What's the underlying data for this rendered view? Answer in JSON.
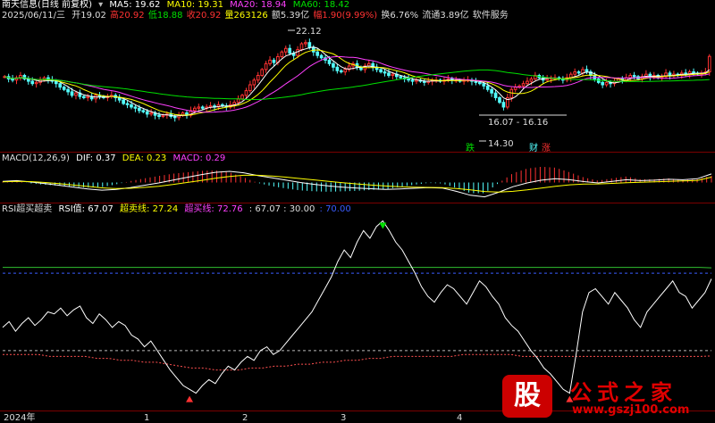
{
  "header": {
    "stock_title": "南天信息(日线 前复权)",
    "ma5": "MA5: 19.62",
    "ma10": "MA10: 19.31",
    "ma20": "MA20: 18.94",
    "ma60": "MA60: 18.42",
    "date": "2025/06/11/三",
    "open": "开19.02",
    "high": "高20.92",
    "low": "低18.88",
    "close": "收20.92",
    "volume": "量263126",
    "amount": "额5.39亿",
    "change": "幅1.90(9.99%)",
    "turnover": "换6.76%",
    "float_cap": "流通3.89亿",
    "industry": "软件服务"
  },
  "macd": {
    "title": "MACD(12,26,9)",
    "dif": "DIF: 0.37",
    "dea": "DEA: 0.23",
    "macd": "MACD: 0.29"
  },
  "rsi": {
    "title": "RSI超买超卖",
    "rsi_value": "RSI值: 67.07",
    "oversold": "超卖线: 27.24",
    "overbought": "超买线: 72.76",
    "levels": ": 67.07 : 30.00",
    "level_blue": ": 70.00"
  },
  "annotations": {
    "high_label": "22.12",
    "low_label": "14.30",
    "range_label": "16.07 - 16.16",
    "tag_die": "跌",
    "tag_cai": "财",
    "tag_zhang": "涨"
  },
  "x_axis": {
    "year": "2024年",
    "months": [
      "1",
      "2",
      "3",
      "4"
    ]
  },
  "watermark": {
    "logo": "股",
    "name": "公式之家",
    "url": "www.gszj100.com"
  },
  "colors": {
    "up": "#ff3232",
    "down": "#54ffff",
    "ma5": "#ffffff",
    "ma10": "#ffff00",
    "ma20": "#ff40ff",
    "ma60": "#00e000",
    "rsi": "#ffffff",
    "oversold": "#ff5050",
    "overbought": "#30c030",
    "level70": "#3a5cff",
    "level30": "#bbbbbb"
  },
  "chart_data": [
    {
      "type": "candlestick",
      "title": "南天信息(日线 前复权)",
      "ylim": [
        13.4,
        23.6
      ],
      "series_names": [
        "MA5",
        "MA10",
        "MA20",
        "MA60"
      ],
      "close": [
        19.2,
        19.0,
        18.9,
        19.1,
        19.3,
        19.0,
        18.8,
        18.6,
        18.7,
        18.9,
        19.1,
        18.9,
        18.8,
        18.6,
        18.3,
        18.1,
        17.9,
        17.6,
        17.8,
        17.5,
        17.4,
        17.5,
        17.3,
        17.6,
        17.5,
        17.4,
        17.5,
        17.6,
        17.4,
        17.2,
        16.9,
        16.8,
        16.6,
        16.5,
        16.3,
        16.2,
        16.0,
        16.1,
        15.9,
        15.8,
        15.9,
        16.0,
        15.8,
        15.7,
        15.9,
        16.1,
        15.9,
        16.3,
        16.5,
        16.6,
        16.5,
        16.6,
        16.7,
        16.6,
        16.8,
        16.7,
        16.6,
        16.8,
        17.0,
        17.3,
        17.6,
        18.0,
        18.5,
        18.9,
        19.3,
        19.8,
        20.3,
        20.6,
        20.4,
        20.9,
        21.3,
        21.6,
        21.2,
        21.0,
        21.5,
        22.0,
        22.1,
        21.7,
        21.3,
        21.0,
        20.8,
        20.6,
        20.3,
        20.0,
        19.7,
        19.6,
        19.8,
        20.1,
        20.3,
        20.0,
        19.8,
        20.1,
        20.3,
        20.0,
        19.8,
        19.6,
        19.5,
        19.3,
        19.4,
        19.2,
        19.1,
        19.0,
        18.9,
        18.8,
        18.9,
        18.8,
        18.7,
        18.8,
        18.9,
        18.9,
        18.8,
        18.9,
        19.0,
        18.9,
        18.9,
        18.8,
        18.9,
        18.9,
        18.8,
        18.7,
        18.6,
        18.4,
        18.1,
        17.8,
        17.4,
        17.0,
        16.6,
        17.4,
        18.1,
        18.3,
        18.4,
        18.6,
        18.8,
        19.0,
        19.3,
        19.1,
        18.9,
        19.0,
        19.1,
        19.1,
        19.0,
        18.9,
        19.1,
        19.4,
        19.6,
        19.5,
        19.8,
        19.6,
        19.3,
        19.0,
        18.7,
        18.5,
        18.7,
        18.6,
        18.8,
        19.0,
        18.9,
        19.1,
        19.3,
        19.2,
        19.0,
        19.2,
        19.4,
        19.2,
        19.3,
        19.1,
        19.2,
        19.5,
        19.3,
        19.4,
        19.3,
        19.5,
        19.4,
        19.6,
        19.5,
        19.4,
        19.5,
        19.6,
        20.92
      ]
    },
    {
      "type": "line",
      "title": "MACD(12,26,9)",
      "series": [
        {
          "name": "DIF",
          "values": [
            0.05,
            0.08,
            0.02,
            -0.05,
            -0.12,
            -0.2,
            -0.28,
            -0.33,
            -0.3,
            -0.22,
            -0.12,
            -0.02,
            0.1,
            0.22,
            0.34,
            0.44,
            0.48,
            0.42,
            0.3,
            0.2,
            0.1,
            0.0,
            -0.08,
            -0.15,
            -0.2,
            -0.24,
            -0.27,
            -0.3,
            -0.28,
            -0.25,
            -0.22,
            -0.24,
            -0.38,
            -0.55,
            -0.62,
            -0.42,
            -0.18,
            -0.02,
            0.1,
            0.16,
            0.12,
            0.04,
            -0.02,
            0.05,
            0.12,
            0.08,
            0.1,
            0.14,
            0.12,
            0.16,
            0.37
          ]
        },
        {
          "name": "DEA",
          "values": [
            0.03,
            0.05,
            0.04,
            0.0,
            -0.05,
            -0.11,
            -0.17,
            -0.23,
            -0.26,
            -0.25,
            -0.21,
            -0.16,
            -0.09,
            0.0,
            0.09,
            0.18,
            0.26,
            0.31,
            0.31,
            0.28,
            0.23,
            0.17,
            0.11,
            0.05,
            -0.01,
            -0.06,
            -0.11,
            -0.15,
            -0.18,
            -0.2,
            -0.21,
            -0.22,
            -0.26,
            -0.32,
            -0.39,
            -0.41,
            -0.38,
            -0.32,
            -0.24,
            -0.16,
            -0.1,
            -0.07,
            -0.06,
            -0.04,
            -0.01,
            0.01,
            0.03,
            0.05,
            0.07,
            0.09,
            0.23
          ]
        },
        {
          "name": "MACD",
          "values": [
            0.04,
            0.06,
            -0.04,
            -0.1,
            -0.14,
            -0.18,
            -0.22,
            -0.2,
            -0.08,
            0.06,
            0.18,
            0.28,
            0.38,
            0.44,
            0.5,
            0.52,
            0.44,
            0.22,
            -0.02,
            -0.16,
            -0.26,
            -0.34,
            -0.38,
            -0.4,
            -0.38,
            -0.36,
            -0.32,
            -0.3,
            -0.2,
            -0.1,
            -0.02,
            -0.04,
            -0.24,
            -0.46,
            -0.46,
            -0.02,
            0.4,
            0.6,
            0.68,
            0.64,
            0.44,
            0.22,
            0.08,
            0.18,
            0.26,
            0.14,
            0.14,
            0.18,
            0.1,
            0.14,
            0.29
          ]
        }
      ],
      "ylim": [
        -0.75,
        0.75
      ]
    },
    {
      "type": "line",
      "title": "RSI超买超卖",
      "ylim": [
        0,
        100
      ],
      "series": [
        {
          "name": "RSI值",
          "values": [
            42,
            45,
            40,
            44,
            47,
            43,
            46,
            50,
            49,
            52,
            48,
            51,
            53,
            47,
            44,
            49,
            46,
            42,
            45,
            43,
            38,
            36,
            32,
            35,
            30,
            25,
            20,
            16,
            12,
            10,
            8,
            12,
            15,
            13,
            18,
            22,
            20,
            24,
            27,
            25,
            30,
            32,
            28,
            30,
            34,
            38,
            42,
            46,
            50,
            56,
            62,
            68,
            76,
            82,
            78,
            86,
            92,
            88,
            94,
            97,
            92,
            86,
            82,
            76,
            70,
            63,
            58,
            55,
            60,
            64,
            62,
            58,
            54,
            60,
            66,
            63,
            58,
            54,
            47,
            43,
            40,
            35,
            30,
            26,
            21,
            18,
            14,
            10,
            8,
            28,
            50,
            60,
            62,
            58,
            54,
            60,
            56,
            52,
            46,
            42,
            50,
            54,
            58,
            62,
            66,
            60,
            58,
            52,
            56,
            60,
            67.07
          ]
        },
        {
          "name": "超卖线",
          "values": [
            28,
            28,
            28,
            28,
            27,
            27,
            27,
            27,
            26,
            26,
            25,
            25,
            24,
            24,
            23,
            22,
            21,
            21,
            20,
            20,
            20,
            21,
            21,
            22,
            22,
            23,
            23,
            24,
            24,
            25,
            25,
            26,
            26,
            27,
            27,
            27,
            27,
            27,
            27,
            28,
            28,
            28,
            28,
            28,
            27,
            27,
            27,
            27,
            27,
            27,
            27,
            27,
            27,
            27,
            27,
            27,
            27,
            27,
            27,
            27,
            27.24
          ]
        },
        {
          "name": "超买线",
          "values": [
            73,
            73,
            73,
            73,
            73,
            73,
            73,
            73,
            73,
            73,
            73,
            73,
            73,
            73,
            73,
            73,
            73,
            73,
            73,
            73,
            73,
            73,
            73,
            73,
            73,
            73,
            73,
            73,
            73,
            73,
            73,
            73,
            73,
            73,
            73,
            73,
            73,
            73,
            73,
            73,
            73,
            73,
            73,
            73,
            73,
            73,
            73,
            73,
            73,
            73,
            73,
            73,
            73,
            73,
            73,
            73,
            73,
            73,
            73,
            73,
            72.76
          ]
        }
      ],
      "levels": [
        70,
        30
      ]
    }
  ]
}
